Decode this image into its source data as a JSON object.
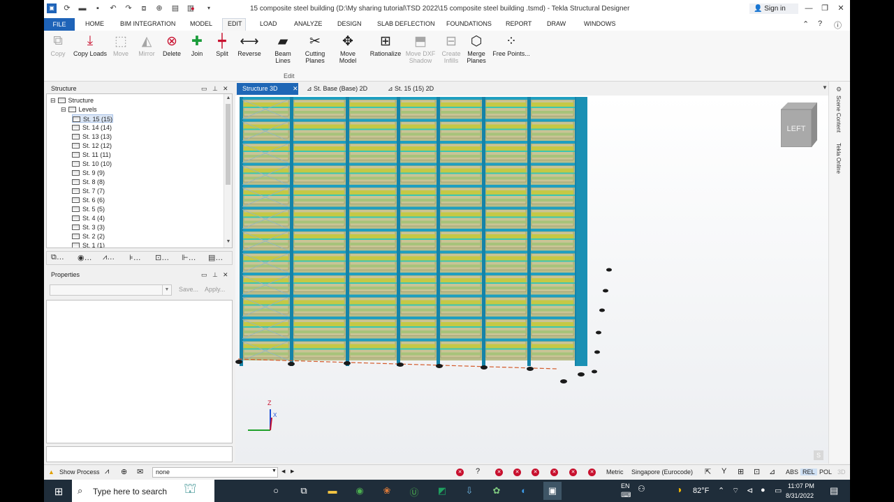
{
  "window": {
    "title": "15 composite steel building  (D:\\My sharing tutorial\\TSD 2022\\15 composite steel building .tsmd) - Tekla Structural Designer",
    "signin": "Sign in"
  },
  "menu": {
    "file": "FILE",
    "items": [
      "HOME",
      "BIM INTEGRATION",
      "MODEL",
      "EDIT",
      "LOAD",
      "ANALYZE",
      "DESIGN",
      "SLAB DEFLECTION",
      "FOUNDATIONS",
      "REPORT",
      "DRAW",
      "WINDOWS"
    ]
  },
  "ribbon": {
    "buttons": [
      "Copy",
      "Copy Loads",
      "Move",
      "Mirror",
      "Delete",
      "Join",
      "Split",
      "Reverse",
      "Beam Lines",
      "Cutting Planes",
      "Move Model",
      "Rationalize",
      "Move DXF Shadow",
      "Create Infills",
      "Merge Planes",
      "Free Points..."
    ],
    "group_label": "Edit"
  },
  "structure_panel": {
    "title": "Structure",
    "root": "Structure",
    "levels_label": "Levels",
    "levels": [
      "St. 15 (15)",
      "St. 14 (14)",
      "St. 13 (13)",
      "St. 12 (12)",
      "St. 11 (11)",
      "St. 10 (10)",
      "St. 9 (9)",
      "St. 8 (8)",
      "St. 7 (7)",
      "St. 6 (6)",
      "St. 5 (5)",
      "St. 4 (4)",
      "St. 3 (3)",
      "St. 2 (2)",
      "St. 1 (1)"
    ]
  },
  "properties_panel": {
    "title": "Properties",
    "save": "Save...",
    "apply": "Apply..."
  },
  "doc_tabs": [
    "Structure 3D",
    "St. Base (Base) 2D",
    "St. 15 (15) 2D"
  ],
  "view": {
    "cube_label": "LEFT",
    "side_labels": [
      "Scene Content",
      "Tekla Online"
    ],
    "axis_z": "Z",
    "axis_x": "X",
    "corner_badge": "S"
  },
  "status": {
    "show_process": "Show Process",
    "command_value": "none",
    "units": "Metric",
    "code": "Singapore (Eurocode)",
    "modes": [
      "ABS",
      "REL",
      "POL",
      "3D"
    ]
  },
  "taskbar": {
    "search_placeholder": "Type here to search",
    "weather": "82°F",
    "lang": "EN",
    "time": "11:07 PM",
    "date": "8/31/2022"
  },
  "colors": {
    "accent": "#1e63b8",
    "steel": "#1f9fc0",
    "deck": "#c5c845",
    "status_red": "#c8102e"
  }
}
